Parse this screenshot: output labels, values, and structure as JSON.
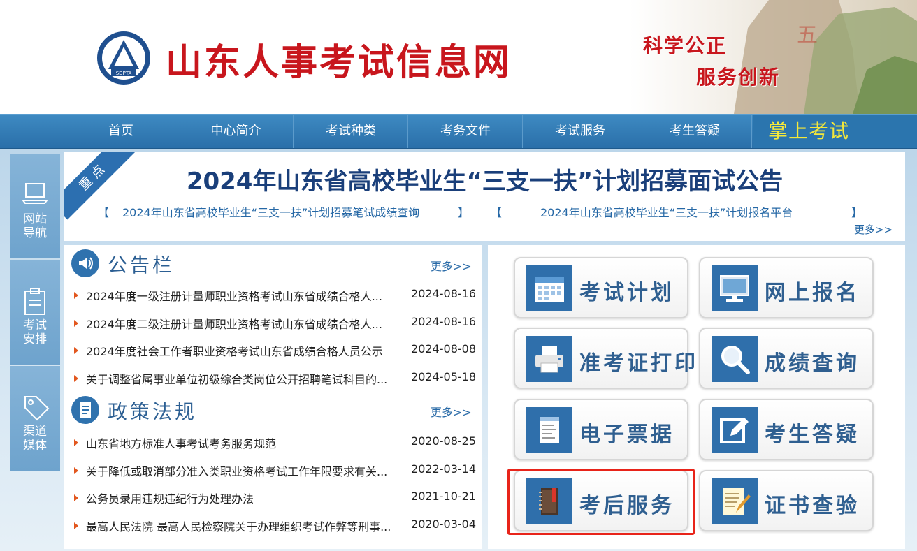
{
  "header": {
    "site_title": "山东人事考试信息网",
    "logo_text": "SDPTA",
    "slogan_line1": "科学公正",
    "slogan_line2": "服务创新"
  },
  "nav": {
    "items": [
      "首页",
      "中心简介",
      "考试种类",
      "考务文件",
      "考试服务",
      "考生答疑"
    ],
    "mobile": "掌上考试"
  },
  "sidebar": {
    "items": [
      {
        "line1": "网站",
        "line2": "导航"
      },
      {
        "line1": "考试",
        "line2": "安排"
      },
      {
        "line1": "渠道",
        "line2": "媒体"
      }
    ]
  },
  "headline": {
    "badge": "重点",
    "title": "2024年山东省高校毕业生“三支一扶”计划招募面试公告",
    "links": [
      "2024年山东省高校毕业生“三支一扶”计划招募笔试成绩查询",
      "2024年山东省高校毕业生“三支一扶”计划报名平台"
    ],
    "bracket_open": "【",
    "bracket_close": "】",
    "more": "更多>>"
  },
  "notices": {
    "title": "公告栏",
    "more": "更多>>",
    "rows": [
      {
        "title": "2024年度一级注册计量师职业资格考试山东省成绩合格人...",
        "date": "2024-08-16"
      },
      {
        "title": "2024年度二级注册计量师职业资格考试山东省成绩合格人...",
        "date": "2024-08-16"
      },
      {
        "title": "2024年度社会工作者职业资格考试山东省成绩合格人员公示",
        "date": "2024-08-08"
      },
      {
        "title": "关于调整省属事业单位初级综合类岗位公开招聘笔试科目的...",
        "date": "2024-05-18"
      }
    ]
  },
  "policies": {
    "title": "政策法规",
    "more": "更多>>",
    "rows": [
      {
        "title": "山东省地方标准人事考试考务服务规范",
        "date": "2020-08-25"
      },
      {
        "title": "关于降低或取消部分准入类职业资格考试工作年限要求有关...",
        "date": "2022-03-14"
      },
      {
        "title": "公务员录用违规违纪行为处理办法",
        "date": "2021-10-21"
      },
      {
        "title": "最高人民法院 最高人民检察院关于办理组织考试作弊等刑事...",
        "date": "2020-03-04"
      }
    ]
  },
  "services": [
    {
      "label": "考试计划",
      "icon": "calendar-icon"
    },
    {
      "label": "网上报名",
      "icon": "monitor-icon"
    },
    {
      "label": "准考证打印",
      "icon": "printer-icon"
    },
    {
      "label": "成绩查询",
      "icon": "magnifier-icon"
    },
    {
      "label": "电子票据",
      "icon": "receipt-icon"
    },
    {
      "label": "考生答疑",
      "icon": "edit-icon"
    },
    {
      "label": "考后服务",
      "icon": "book-icon"
    },
    {
      "label": "证书查验",
      "icon": "certificate-icon"
    }
  ],
  "colors": {
    "brand_red": "#c8161d",
    "nav_blue": "#2a6fa9",
    "accent_yellow": "#f5e83a",
    "highlight_red": "#e8241a"
  }
}
